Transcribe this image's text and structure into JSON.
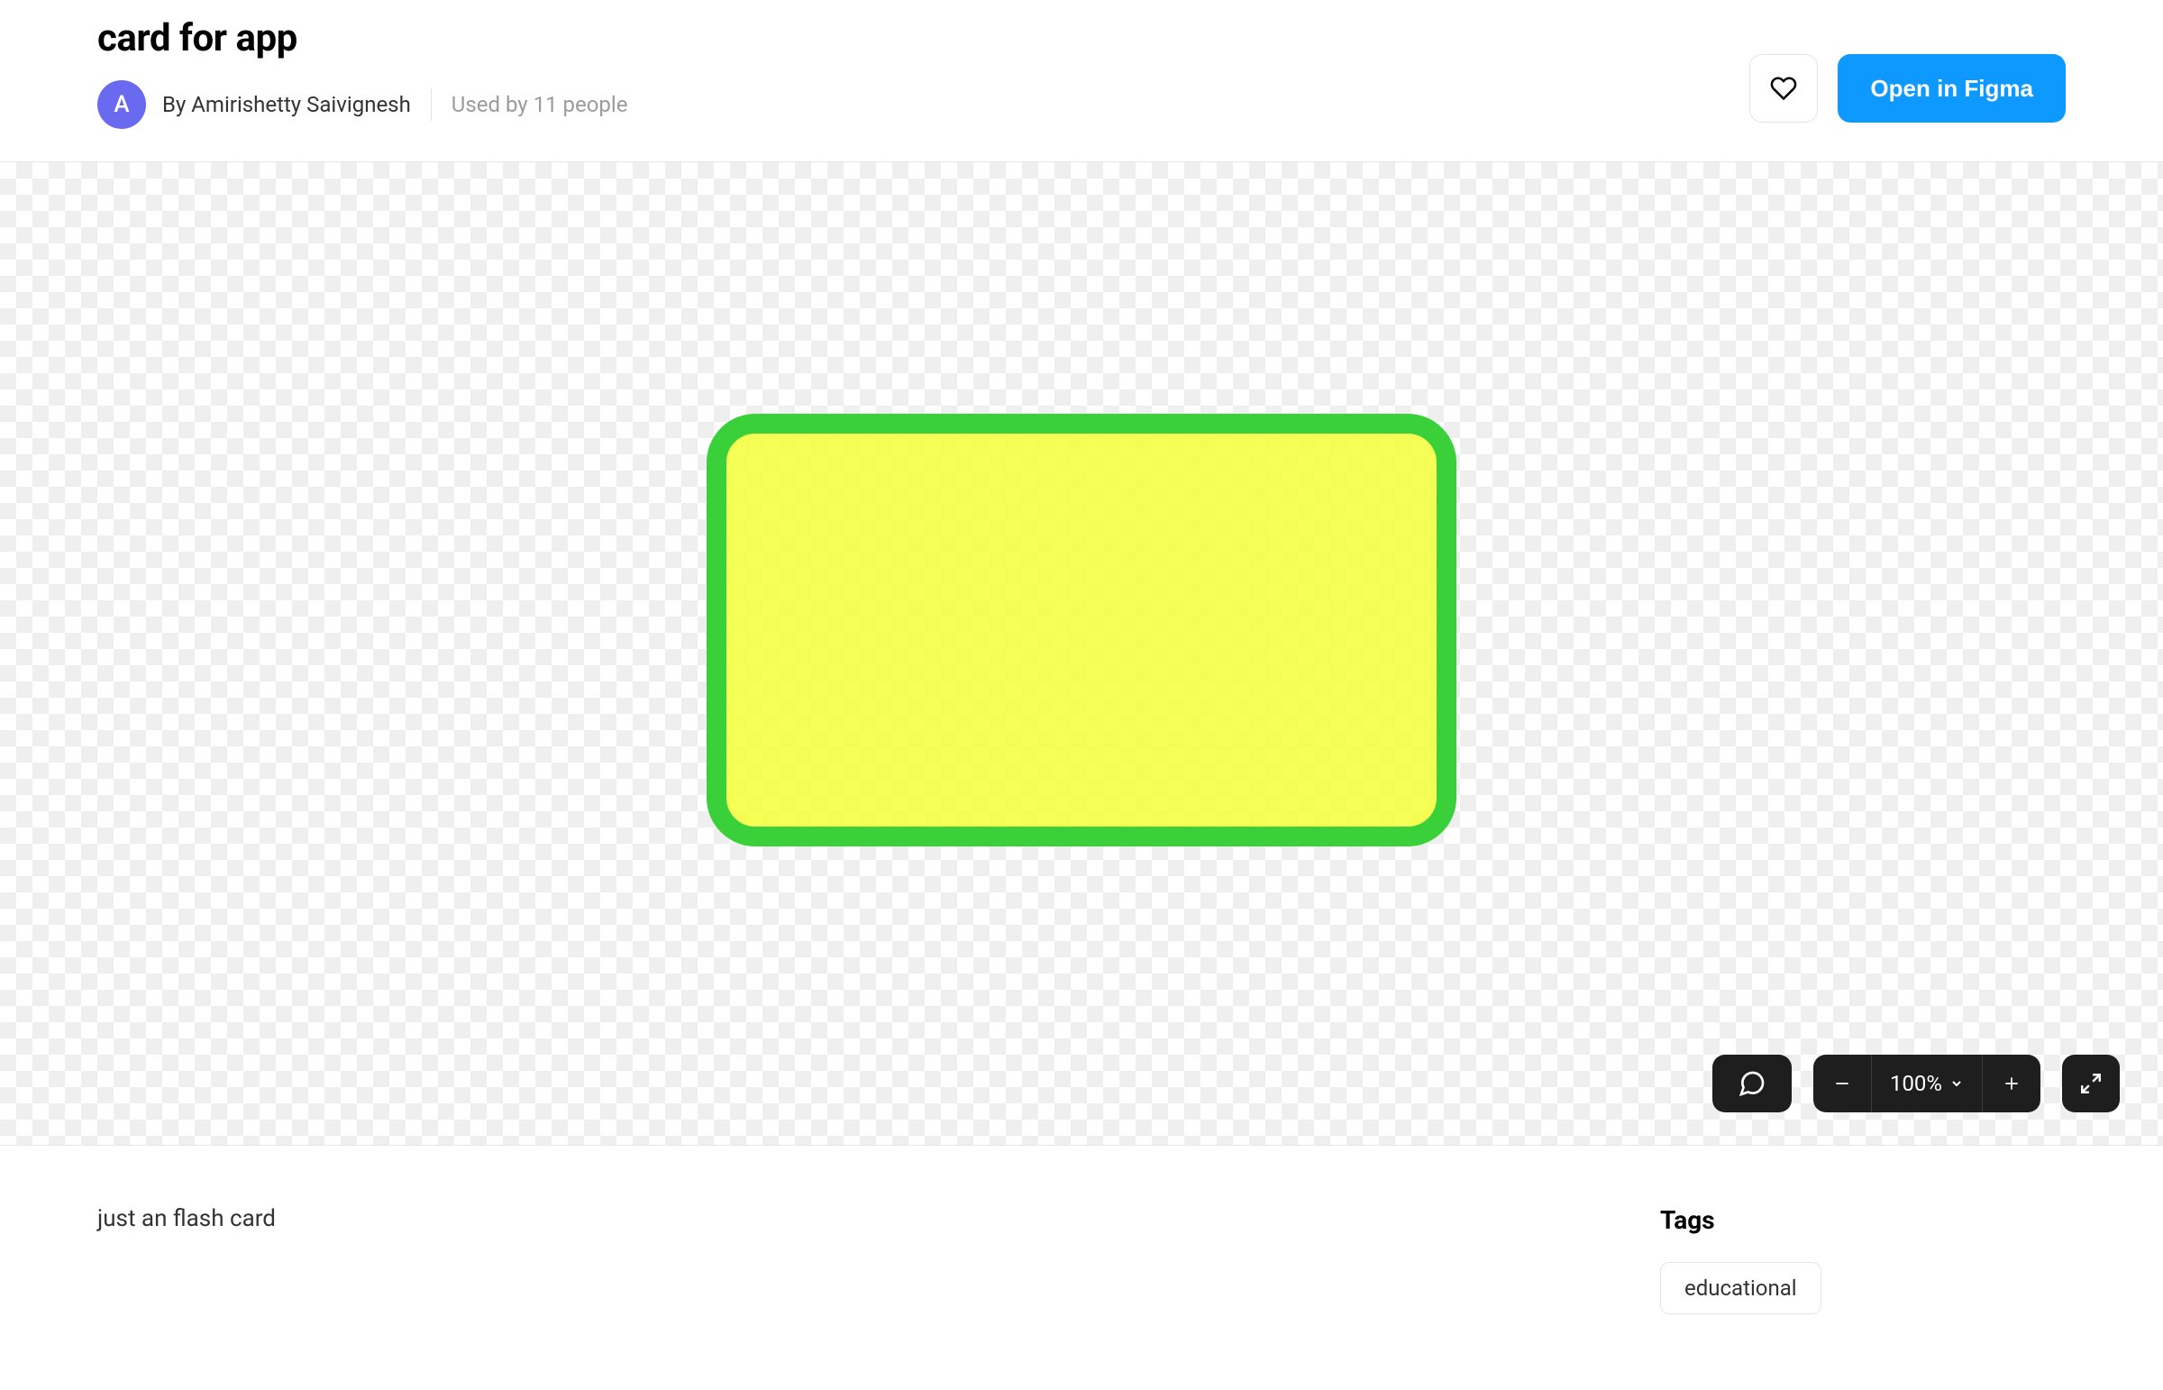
{
  "header": {
    "title": "card for app",
    "author_initial": "A",
    "by_prefix": "By ",
    "author_name": "Amirishetty Saivignesh",
    "usage_text": "Used by 11 people",
    "open_button": "Open in Figma"
  },
  "canvas": {
    "zoom_level": "100%",
    "card_border_color": "#39d039",
    "card_fill_color": "#f2ff3d"
  },
  "footer": {
    "description": "just an flash card",
    "tags_heading": "Tags",
    "tags": [
      "educational"
    ]
  }
}
